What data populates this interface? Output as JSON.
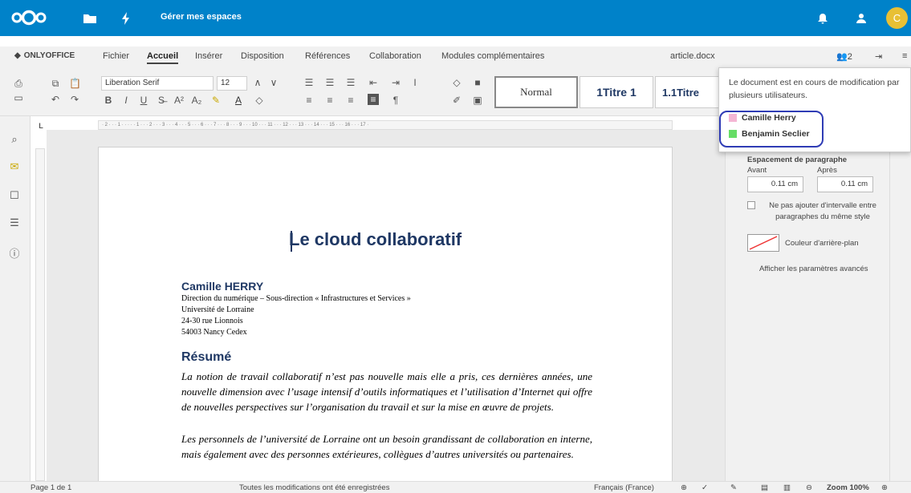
{
  "nextcloud": {
    "workspace_label": "Gérer mes espaces",
    "avatar_letter": "C",
    "accent": "#0082c9"
  },
  "editor": {
    "brand": "ONLYOFFICE",
    "tabs": [
      "Fichier",
      "Accueil",
      "Insérer",
      "Disposition",
      "Références",
      "Collaboration",
      "Modules complémentaires"
    ],
    "active_tab": "Accueil",
    "filename": "article.docx",
    "users_count": "2"
  },
  "toolbar": {
    "font_name": "Liberation Serif",
    "font_size": "12",
    "styles": [
      "Normal",
      "1Titre 1",
      "1.1Titre"
    ]
  },
  "popup": {
    "message": "Le document est en cours de modification par plusieurs utilisateurs.",
    "users": [
      {
        "name": "Camille Herry",
        "color": "#f4b6d4"
      },
      {
        "name": "Benjamin Seclier",
        "color": "#66dd66"
      }
    ]
  },
  "right_panel": {
    "spacing_title": "Espacement de paragraphe",
    "before_label": "Avant",
    "after_label": "Après",
    "before_value": "0.11 cm",
    "after_value": "0.11 cm",
    "no_interval_label": "Ne pas ajouter d'intervalle entre paragraphes du même style",
    "bg_color_label": "Couleur d'arrière-plan",
    "advanced_link": "Afficher les paramètres avancés"
  },
  "document": {
    "title": "Le cloud collaboratif",
    "author": "Camille HERRY",
    "address": [
      "Direction du numérique – Sous-direction « Infrastructures et Services »",
      "Université de Lorraine",
      "24-30 rue Lionnois",
      "54003 Nancy Cedex"
    ],
    "section": "Résumé",
    "paragraph1": "La notion de travail collaboratif n’est pas nouvelle mais elle a pris, ces dernières années, une nouvelle dimension avec l’usage intensif d’outils informatiques et l’utilisation d’Internet qui offre de nouvelles perspectives sur l’organisation du travail et sur la mise en œuvre de projets.",
    "paragraph2": "Les personnels de l’université de Lorraine ont un besoin grandissant de collaboration en interne, mais également avec des personnes extérieures, collègues d’autres universités ou partenaires."
  },
  "ruler_text": "· 2 · · · 1 · · · · · 1 · · · 2 · · · 3 · · · 4 · · · 5 · · · 6 · · · 7 · · · 8 · · · 9 · · · 10 · · · 11 · · · 12 · · · 13 · · · 14 · · · 15 · · · 16 · · · 17 ·",
  "status": {
    "page": "Page 1 de 1",
    "saved": "Toutes les modifications ont été enregistrées",
    "language": "Français (France)",
    "zoom": "Zoom 100%"
  }
}
